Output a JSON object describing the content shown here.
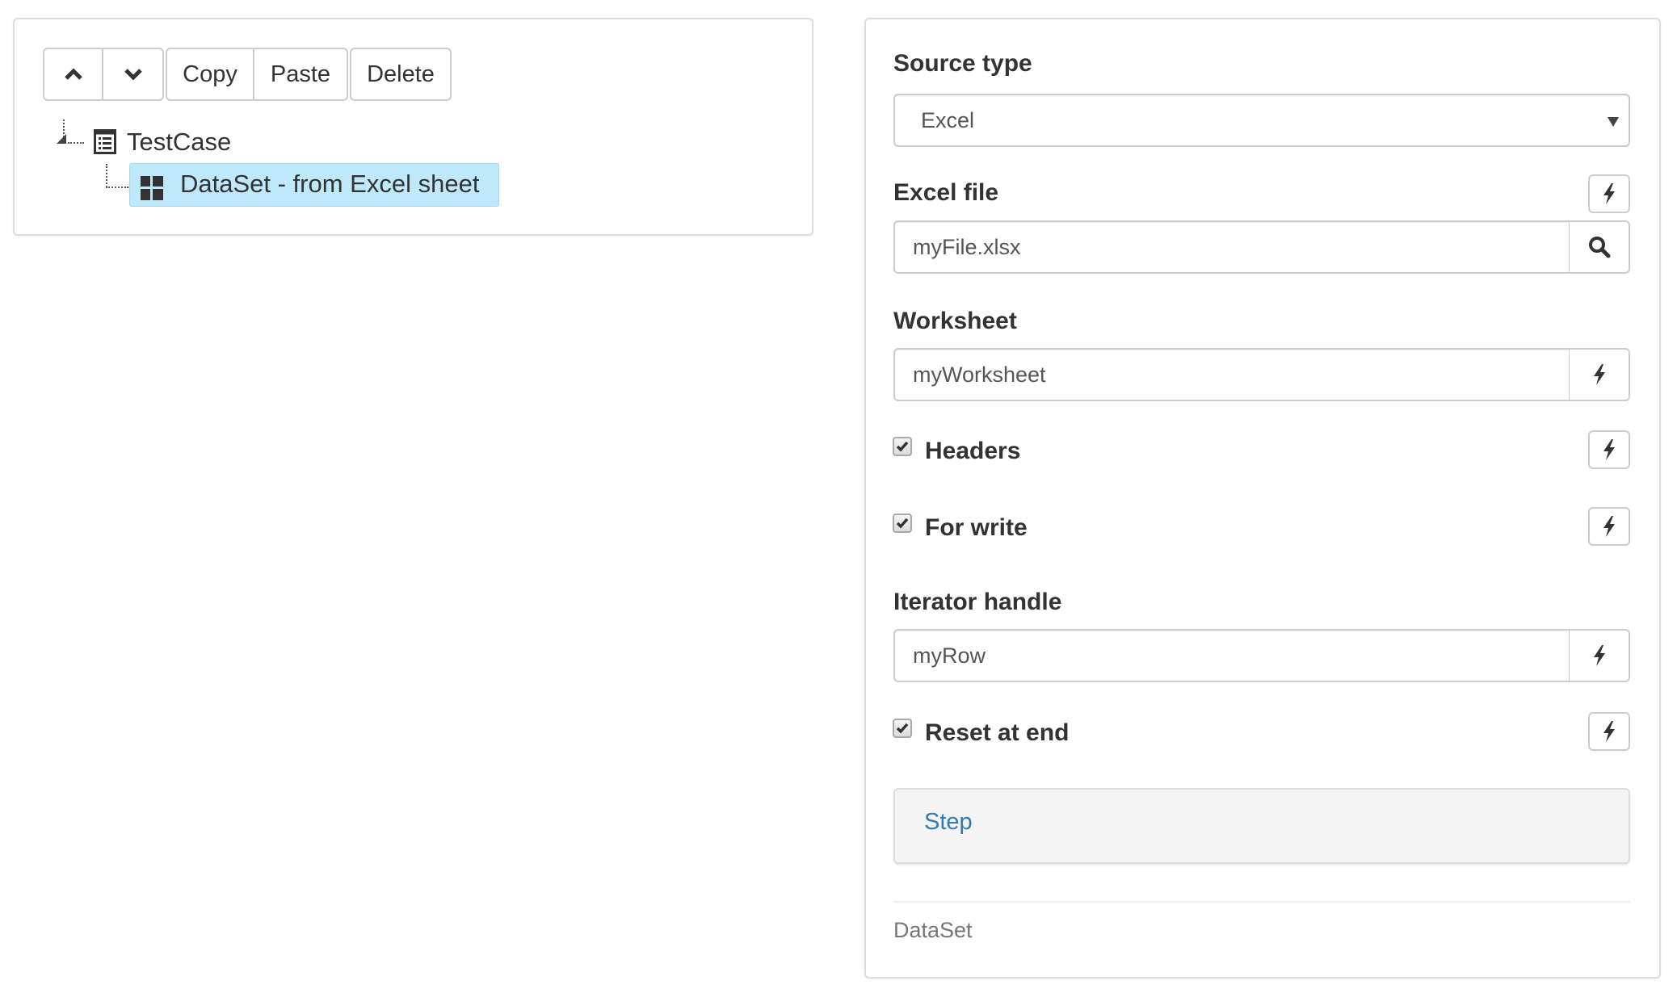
{
  "toolbar": {
    "move_up_icon": "chevron-up",
    "move_down_icon": "chevron-down",
    "copy_label": "Copy",
    "paste_label": "Paste",
    "delete_label": "Delete"
  },
  "tree": {
    "root": {
      "label": "TestCase",
      "icon": "list-alt-icon"
    },
    "children": [
      {
        "label": "DataSet - from Excel sheet",
        "icon": "th-large-icon",
        "selected": true
      }
    ],
    "selected_bg": "#bfe9fb"
  },
  "form": {
    "source_type": {
      "label": "Source type",
      "value": "Excel"
    },
    "excel_file": {
      "label": "Excel file",
      "value": "myFile.xlsx"
    },
    "worksheet": {
      "label": "Worksheet",
      "value": "myWorksheet"
    },
    "headers": {
      "label": "Headers",
      "checked": true
    },
    "for_write": {
      "label": "For write",
      "checked": true
    },
    "iterator_handle": {
      "label": "Iterator handle",
      "value": "myRow"
    },
    "reset_at_end": {
      "label": "Reset at end",
      "checked": true
    }
  },
  "step_panel": {
    "label": "Step",
    "link_color": "#337ab7"
  },
  "footer": {
    "type_label": "DataSet"
  }
}
